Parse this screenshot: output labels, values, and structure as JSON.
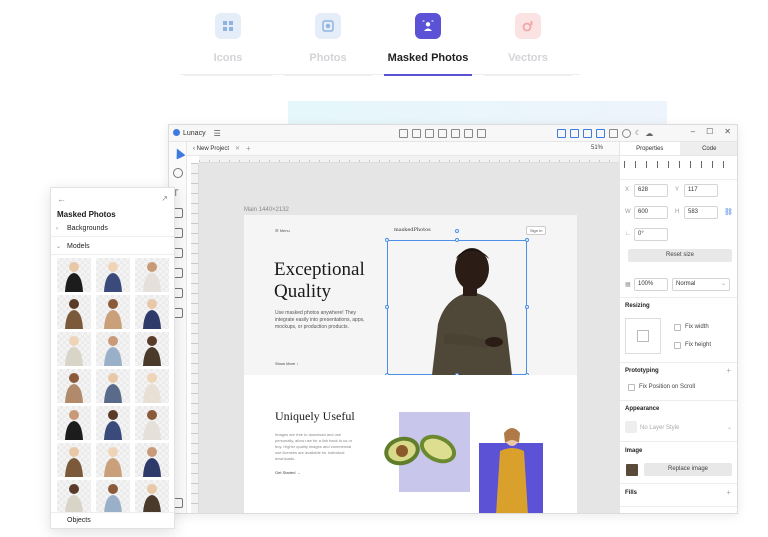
{
  "categories": {
    "tabs": [
      {
        "label": "Icons",
        "icon": "grid-icon",
        "color": "#8fb3e0",
        "bg": "#e4edf8",
        "active": false
      },
      {
        "label": "Photos",
        "icon": "photo-icon",
        "color": "#8fb3e0",
        "bg": "#e4edf8",
        "active": false
      },
      {
        "label": "Masked Photos",
        "icon": "user-badge-icon",
        "color": "#ffffff",
        "bg": "#5b52d6",
        "active": true
      },
      {
        "label": "Vectors",
        "icon": "vector-icon",
        "color": "#f3a6a6",
        "bg": "#fbe3e3",
        "active": false
      }
    ]
  },
  "app": {
    "name": "Lunacy",
    "document_tab": "New Project",
    "zoom": "51%",
    "window_controls": [
      "–",
      "☐",
      "✕"
    ]
  },
  "canvas": {
    "frame_label": "Main",
    "frame_size": "1440×2132",
    "hero": {
      "nav": "Menu",
      "brand": "maskedPhotos",
      "signin": "Sign In",
      "title_line1": "Exceptional",
      "title_line2": "Quality",
      "description": "Use masked photos anywhere! They integrate easily into presentations, apps, mockups, or production products.",
      "more": "Show More ↓"
    },
    "section2": {
      "title": "Uniquely Useful",
      "description": "Images are free to download and use personally, allow use for a link back to us or buy. Higher quality images and commercial use licenses are available for individual downloads.",
      "link": "Get Started →"
    }
  },
  "properties": {
    "tabs": [
      "Properties",
      "Code"
    ],
    "x_label": "X",
    "x": "628",
    "y_label": "Y",
    "y": "117",
    "w_label": "W",
    "w": "600",
    "h_label": "H",
    "h": "583",
    "rotation": "0°",
    "reset_size": "Reset size",
    "opacity": "100%",
    "blend": "Normal",
    "resizing_title": "Resizing",
    "fix_width": "Fix width",
    "fix_height": "Fix height",
    "prototyping_title": "Prototyping",
    "fix_position": "Fix Position on Scroll",
    "appearance_title": "Appearance",
    "layer_style": "No Layer Style",
    "image_title": "Image",
    "replace_image": "Replace image",
    "fills_title": "Fills"
  },
  "side_panel": {
    "title": "Masked Photos",
    "back": "←",
    "external": "↗",
    "sections": [
      "Backgrounds",
      "Models"
    ],
    "objects": "Objects"
  }
}
